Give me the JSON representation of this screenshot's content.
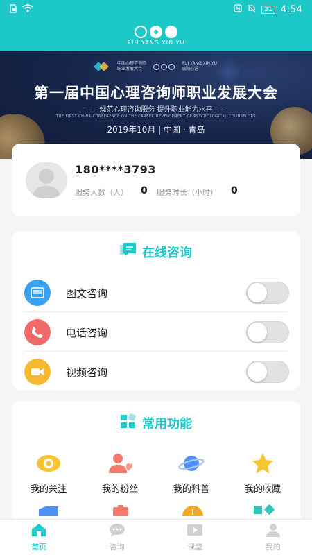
{
  "status_bar": {
    "time": "4:54",
    "battery": "21",
    "left_icons": [
      "sim-icon",
      "wifi-icon"
    ],
    "right_icons": [
      "nfc-icon",
      "mute-icon",
      "battery-icon"
    ]
  },
  "header": {
    "logo_text": "RUI YANG XIN YU"
  },
  "banner": {
    "logo_left_text_1": "中国心理咨询师",
    "logo_left_text_2": "职业发展大会",
    "logo_right_text_1": "RUI YANG XIN YU",
    "logo_right_text_2": "瑞阳心语",
    "title": "第一届中国心理咨询师职业发展大会",
    "subtitle": "——规范心理咨询服务 提升职业能力水平——",
    "english": "THE FIRST CHINA CONFERENCE ON THE CAREER DEVELOPMENT OF PSYCHOLOGICAL COUNSELORS",
    "date_location": "2019年10月 | 中国 · 青岛"
  },
  "profile": {
    "phone": "180****3793",
    "served_label": "服务人数（人）",
    "served_value": "0",
    "duration_label": "服务时长（小时）",
    "duration_value": "0"
  },
  "consult": {
    "title": "在线咨询",
    "items": [
      {
        "label": "图文咨询",
        "icon": "image-text-icon",
        "color": "#3aa0f0",
        "enabled": false
      },
      {
        "label": "电话咨询",
        "icon": "phone-icon",
        "color": "#f06a6a",
        "enabled": false
      },
      {
        "label": "视频咨询",
        "icon": "video-icon",
        "color": "#f5b82e",
        "enabled": false
      }
    ]
  },
  "functions": {
    "title": "常用功能",
    "items": [
      {
        "label": "我的关注",
        "icon": "eye-icon"
      },
      {
        "label": "我的粉丝",
        "icon": "fans-icon"
      },
      {
        "label": "我的科普",
        "icon": "planet-icon"
      },
      {
        "label": "我的收藏",
        "icon": "star-icon"
      }
    ]
  },
  "tabbar": {
    "items": [
      {
        "label": "首页",
        "icon": "home-icon",
        "active": true
      },
      {
        "label": "咨询",
        "icon": "chat-icon",
        "active": false
      },
      {
        "label": "课堂",
        "icon": "classroom-icon",
        "active": false
      },
      {
        "label": "我的",
        "icon": "profile-icon",
        "active": false
      }
    ]
  },
  "colors": {
    "accent": "#1cc8c8",
    "banner_bg": "#16254a",
    "toggle_off": "#e2e2e2"
  }
}
